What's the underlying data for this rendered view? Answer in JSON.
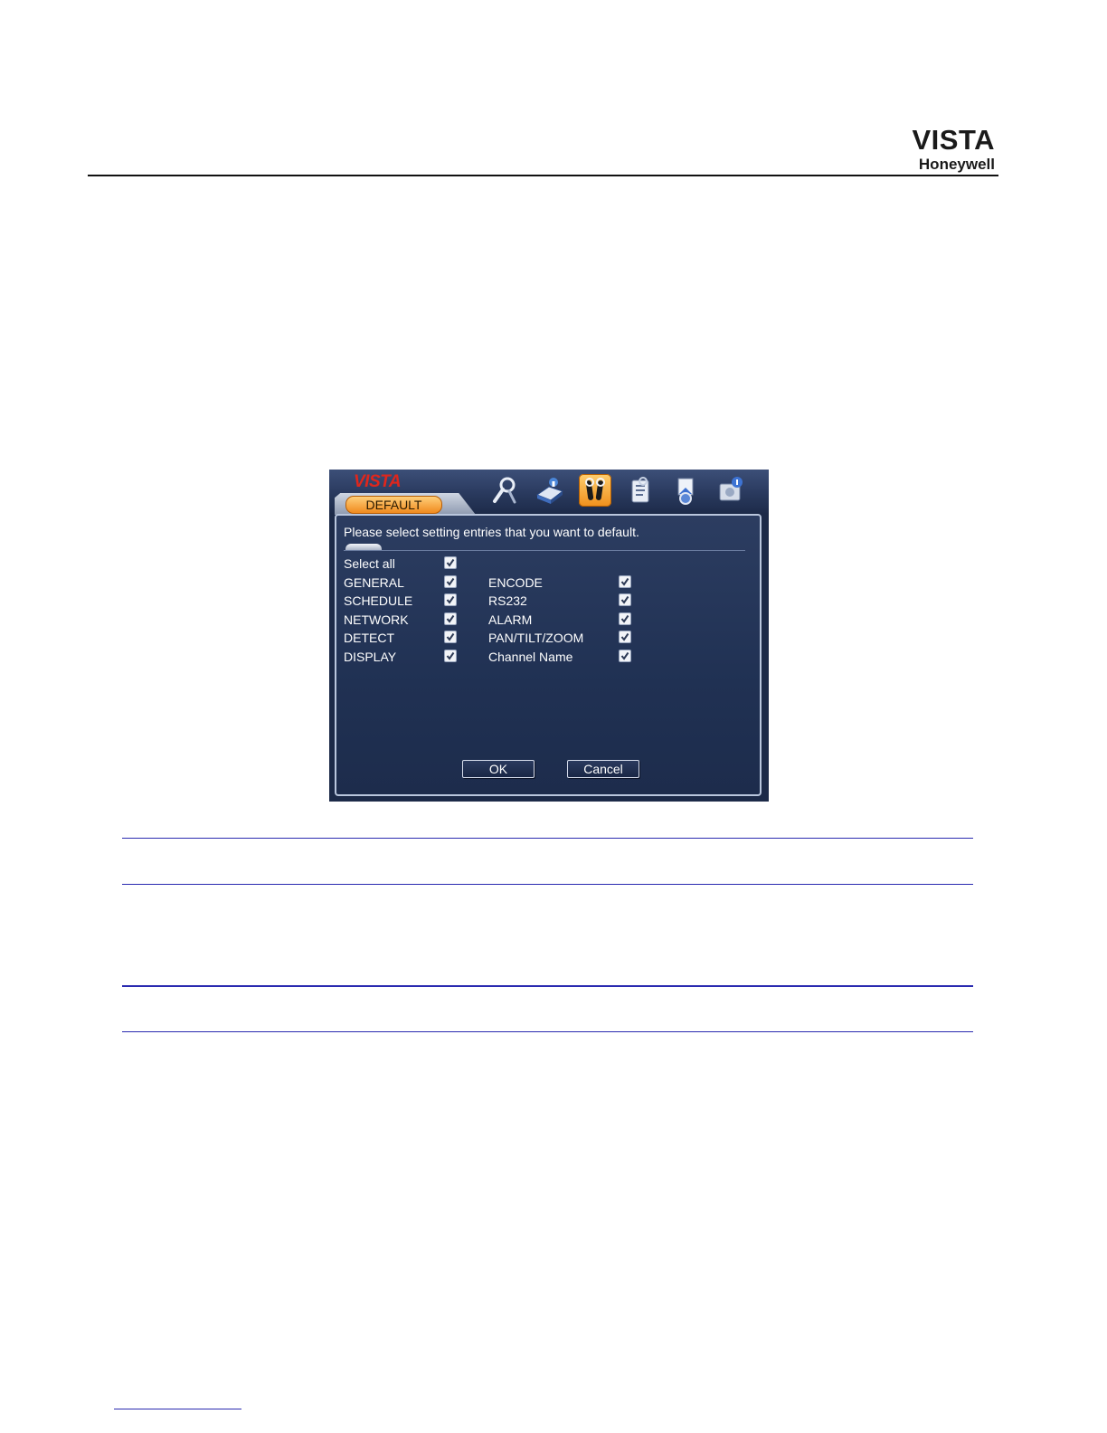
{
  "header": {
    "brand_main": "VISTA",
    "brand_sub": "Honeywell"
  },
  "dialog": {
    "logo": "VISTA",
    "tab_label": "DEFAULT",
    "toolbar_icons": [
      "camera-search-icon",
      "info-book-icon",
      "tools-icon",
      "report-icon",
      "backup-icon",
      "disk-icon"
    ],
    "active_icon": "tools-icon",
    "instruction": "Please select setting entries that you want to default.",
    "select_all": {
      "label": "Select all",
      "checked": true
    },
    "left_options": [
      {
        "label": "GENERAL",
        "checked": true
      },
      {
        "label": "SCHEDULE",
        "checked": true
      },
      {
        "label": "NETWORK",
        "checked": true
      },
      {
        "label": "DETECT",
        "checked": true
      },
      {
        "label": "DISPLAY",
        "checked": true
      }
    ],
    "right_options": [
      {
        "label": "ENCODE",
        "checked": true
      },
      {
        "label": "RS232",
        "checked": true
      },
      {
        "label": "ALARM",
        "checked": true
      },
      {
        "label": "PAN/TILT/ZOOM",
        "checked": true
      },
      {
        "label": "Channel Name",
        "checked": true
      }
    ],
    "ok_label": "OK",
    "cancel_label": "Cancel"
  }
}
